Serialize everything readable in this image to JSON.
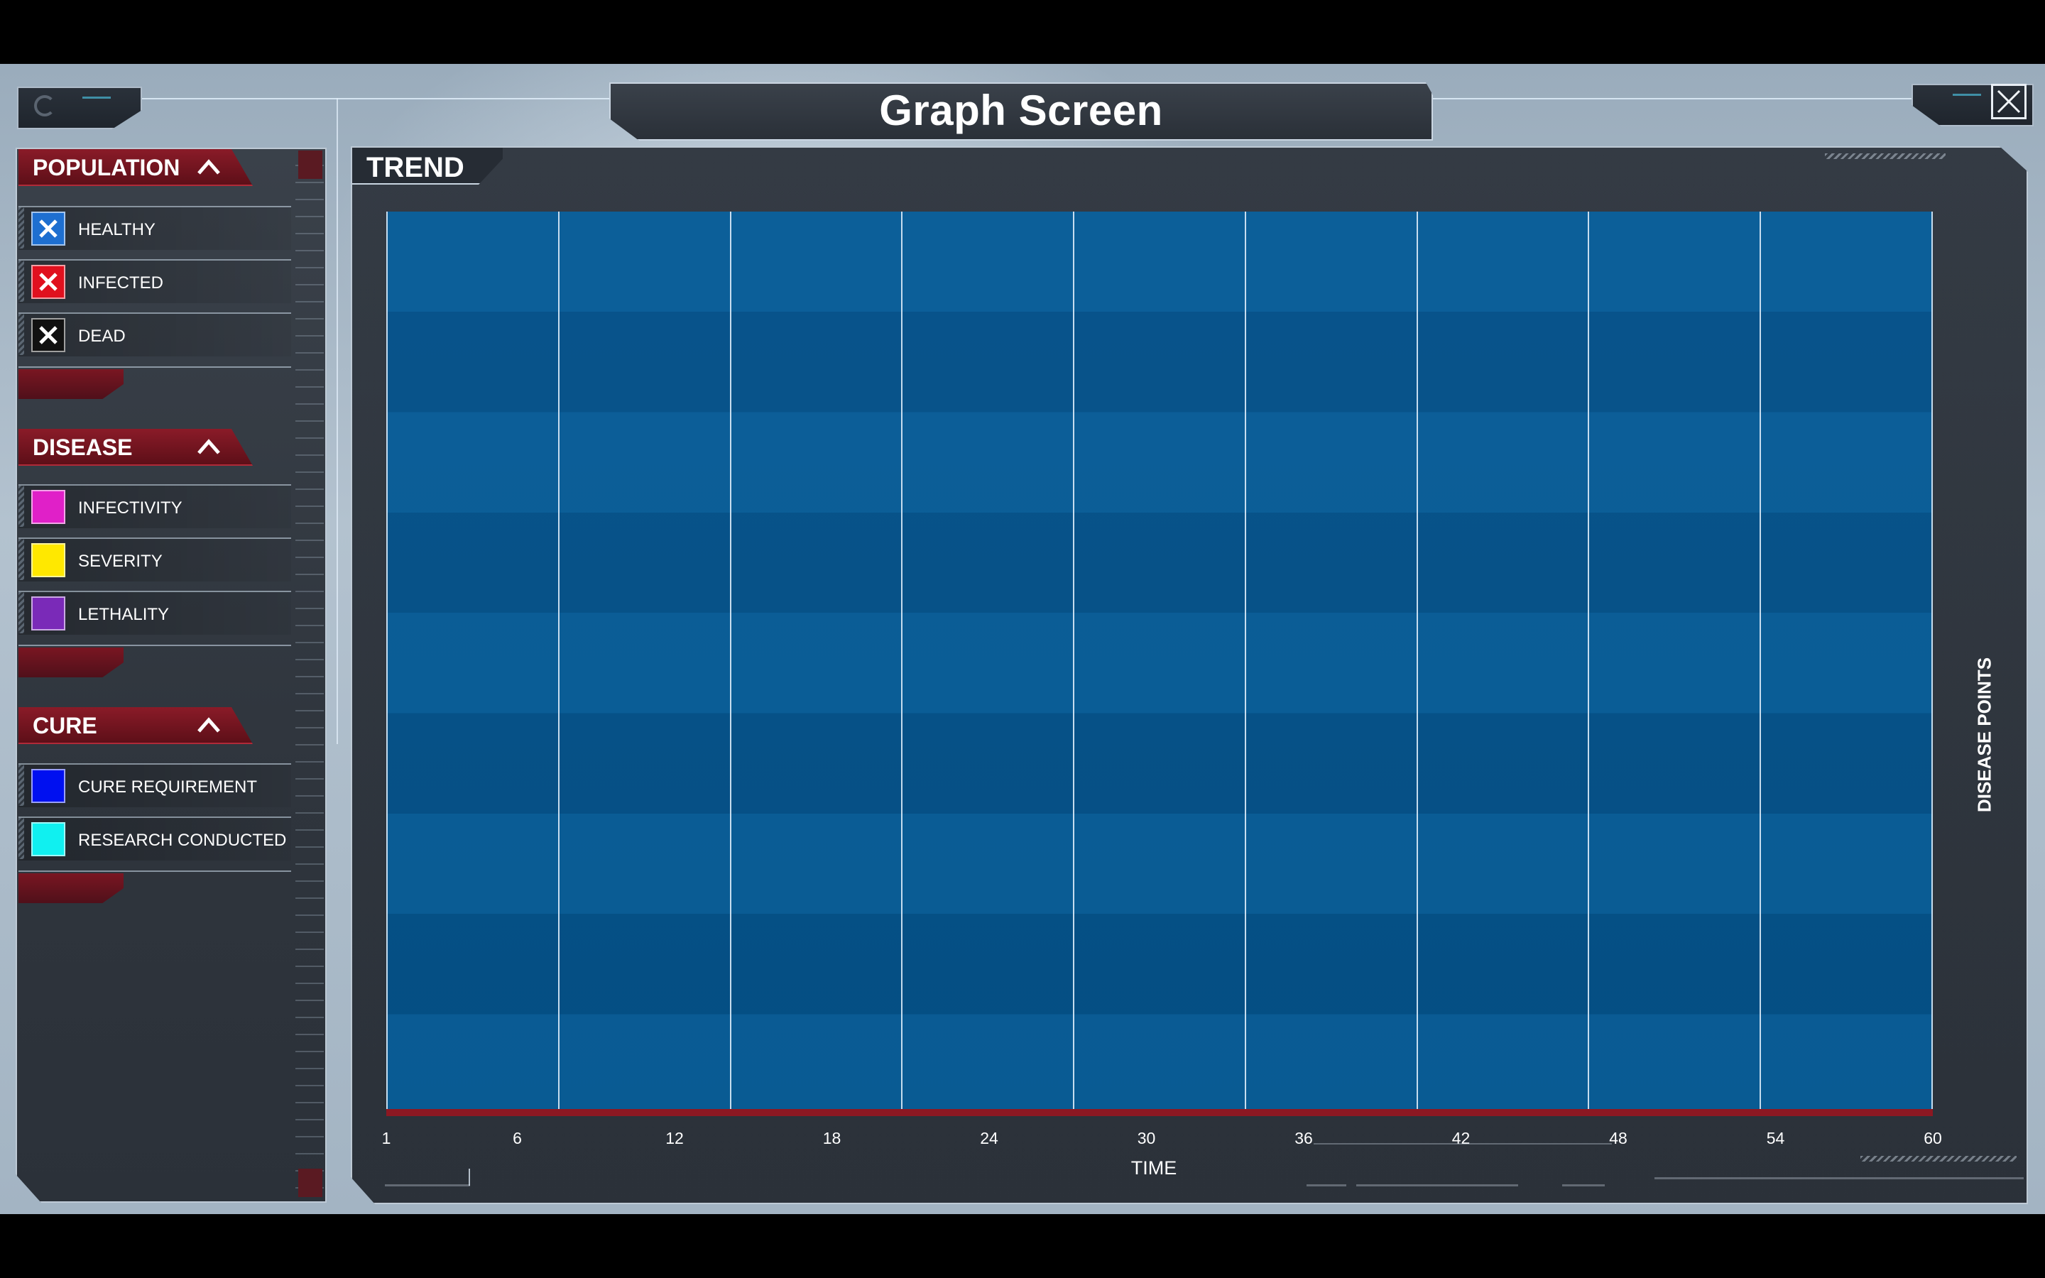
{
  "window": {
    "title": "Graph Screen"
  },
  "sidebar": {
    "sections": [
      {
        "title": "POPULATION",
        "items": [
          {
            "label": "HEALTHY",
            "color": "#1e6fd0",
            "checked": true
          },
          {
            "label": "INFECTED",
            "color": "#e0101e",
            "checked": true
          },
          {
            "label": "DEAD",
            "color": "#111111",
            "checked": true
          }
        ]
      },
      {
        "title": "DISEASE",
        "items": [
          {
            "label": "INFECTIVITY",
            "color": "#e020c8",
            "checked": false
          },
          {
            "label": "SEVERITY",
            "color": "#ffe800",
            "checked": false
          },
          {
            "label": "LETHALITY",
            "color": "#7a2ab8",
            "checked": false
          }
        ]
      },
      {
        "title": "CURE",
        "items": [
          {
            "label": "CURE REQUIREMENT",
            "color": "#0010f0",
            "checked": false
          },
          {
            "label": "RESEARCH CONDUCTED",
            "color": "#10f0f0",
            "checked": false
          }
        ]
      }
    ]
  },
  "main": {
    "tab": "TREND"
  },
  "chart_data": {
    "type": "line",
    "x_ticks": [
      "1",
      "6",
      "12",
      "18",
      "24",
      "30",
      "36",
      "42",
      "48",
      "54",
      "60"
    ],
    "xlabel": "TIME",
    "ylabel": "DISEASE POINTS",
    "xlim": [
      1,
      60
    ],
    "grid": true,
    "series": [],
    "plot_color": "#075790",
    "baseline_color": "#8c1822"
  }
}
